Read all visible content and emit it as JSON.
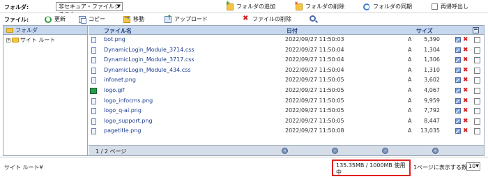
{
  "folderbar": {
    "label": "フォルダ:",
    "selected_folder": "非セキュア・ファイルシステム",
    "add_folder": "フォルダの追加",
    "delete_folder": "フォルダの削除",
    "sync_folder": "フォルダの同期",
    "recursive_call": "再帰呼出し"
  },
  "filebar": {
    "label": "ファイル:",
    "refresh": "更新",
    "copy": "コピー",
    "move": "移動",
    "upload": "アップロード",
    "delete_file": "ファイルの削除"
  },
  "tree": {
    "header": "フォルダ",
    "root": "サイト ルート"
  },
  "list": {
    "headers": {
      "name": "ファイル名",
      "date": "日付",
      "size": "サイズ"
    },
    "files": [
      {
        "name": "bot.png",
        "date": "2022/09/27 11:50:03",
        "attr": "A",
        "size": "5,390",
        "type": "doc"
      },
      {
        "name": "DynamicLogin_Module_3714.css",
        "date": "2022/09/27 11:50:04",
        "attr": "A",
        "size": "1,304",
        "type": "doc"
      },
      {
        "name": "DynamicLogin_Module_3717.css",
        "date": "2022/09/27 11:50:04",
        "attr": "A",
        "size": "1,306",
        "type": "doc"
      },
      {
        "name": "DynamicLogin_Module_434.css",
        "date": "2022/09/27 11:50:04",
        "attr": "A",
        "size": "1,310",
        "type": "doc"
      },
      {
        "name": "infonet.png",
        "date": "2022/09/27 11:50:05",
        "attr": "A",
        "size": "3,602",
        "type": "doc"
      },
      {
        "name": "logo.gif",
        "date": "2022/09/27 11:50:05",
        "attr": "A",
        "size": "4,067",
        "type": "img"
      },
      {
        "name": "logo_infocms.png",
        "date": "2022/09/27 11:50:05",
        "attr": "A",
        "size": "9,959",
        "type": "doc"
      },
      {
        "name": "logo_q-ai.png",
        "date": "2022/09/27 11:50:05",
        "attr": "A",
        "size": "7,792",
        "type": "doc"
      },
      {
        "name": "logo_support.png",
        "date": "2022/09/27 11:50:05",
        "attr": "A",
        "size": "8,447",
        "type": "doc"
      },
      {
        "name": "pagetitle.png",
        "date": "2022/09/27 11:50:08",
        "attr": "A",
        "size": "13,035",
        "type": "doc"
      }
    ]
  },
  "pager": {
    "info": "1 / 2 ページ"
  },
  "status": {
    "path": "サイト ルート¥",
    "quota_line1": "135.35MB / 1000MB 使用",
    "quota_line2": "中",
    "per_page_label": "1ページに表示する数:",
    "per_page_value": "10"
  }
}
